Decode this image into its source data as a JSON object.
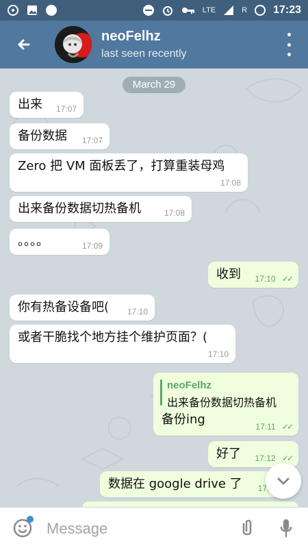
{
  "status_bar": {
    "time": "17:23",
    "network_label": "LTE",
    "sim_label": "R"
  },
  "header": {
    "title": "neoFelhz",
    "subtitle": "last seen recently",
    "icons": [
      "back-arrow-icon",
      "avatar",
      "more-vert-icon"
    ]
  },
  "chat": {
    "date": "March 29",
    "messages": [
      {
        "dir": "in",
        "text": "出来",
        "time": "17:07"
      },
      {
        "dir": "in",
        "text": "备份数据",
        "time": "17:07"
      },
      {
        "dir": "in",
        "text": "Zero 把 VM 面板丢了，打算重装母鸡",
        "time": "17:08"
      },
      {
        "dir": "in",
        "text": "出来备份数据切热备机",
        "time": "17:08"
      },
      {
        "dir": "in",
        "text": "。。。。",
        "time": "17:09"
      },
      {
        "dir": "out",
        "text": "收到",
        "time": "17:10"
      },
      {
        "dir": "in",
        "text": "你有热备设备吧(",
        "time": "17:10"
      },
      {
        "dir": "in",
        "text": "或者干脆找个地方挂个维护页面？(",
        "time": "17:10"
      },
      {
        "dir": "out",
        "reply_to": {
          "name": "neoFelhz",
          "text": "出来备份数据切热备机"
        },
        "text": "备份ing",
        "time": "17:11"
      },
      {
        "dir": "out",
        "text": "好了",
        "time": "17:12"
      },
      {
        "dir": "out",
        "text": "数据在 google drive 了",
        "time": "17:1"
      }
    ]
  },
  "input": {
    "placeholder": "Message"
  },
  "colors": {
    "status_bar": "#3f5f7d",
    "header": "#51789e",
    "chat_bg": "#cfd8dc",
    "outgoing_bubble": "#effedd",
    "incoming_bubble": "#ffffff",
    "tick_green": "#5aa66a",
    "accent_blue": "#3a8fd8"
  }
}
